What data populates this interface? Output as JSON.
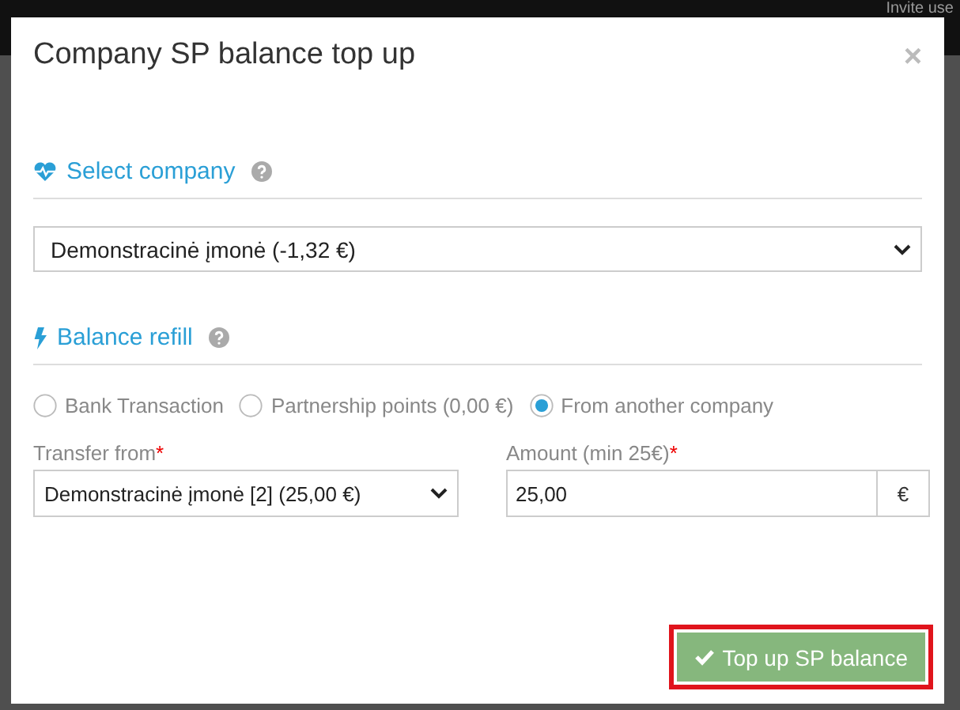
{
  "background": {
    "header_text": "Invite use"
  },
  "modal": {
    "title": "Company SP balance top up",
    "close": "×",
    "company_section": {
      "title": "Select company",
      "kind": "heart"
    },
    "company_select": {
      "value": "Demonstracinė įmonė (-1,32 €)"
    },
    "refill_section": {
      "title": "Balance refill",
      "kind": "bolt"
    },
    "methods": [
      {
        "label": "Bank Transaction",
        "selected": false
      },
      {
        "label": "Partnership points (0,00 €)",
        "selected": false
      },
      {
        "label": "From another company",
        "selected": true
      }
    ],
    "transfer_from": {
      "label": "Transfer from",
      "required": "*",
      "value": "Demonstracinė įmonė [2] (25,00 €)"
    },
    "amount": {
      "label": "Amount (min 25€)",
      "required": "*",
      "value": "25,00",
      "unit": "€"
    },
    "submit": {
      "label": "Top up SP balance",
      "highlighted": true
    }
  }
}
